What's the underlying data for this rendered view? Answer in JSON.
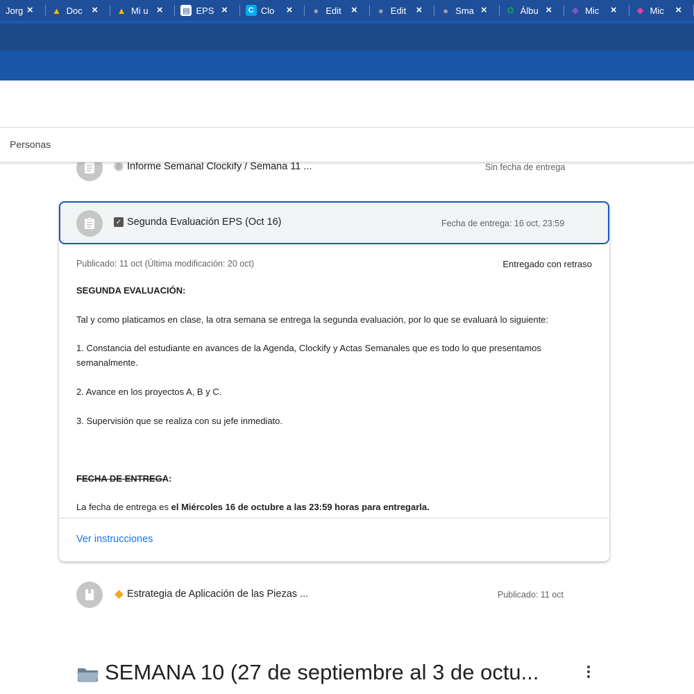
{
  "browser": {
    "tabs": [
      {
        "title": "Jorg",
        "icon": "user-icon",
        "icon_color": "#1f4f9a"
      },
      {
        "title": "Doc",
        "icon": "google-drive-icon",
        "icon_color": "#ffffff"
      },
      {
        "title": "Mi u",
        "icon": "google-drive-icon",
        "icon_color": "#ffffff"
      },
      {
        "title": "EPS",
        "icon": "google-forms-icon",
        "icon_color": "#ffffff"
      },
      {
        "title": "Clo",
        "icon": "clockify-icon",
        "icon_color": "#03a9f4"
      },
      {
        "title": "Edit",
        "icon": "globe-icon",
        "icon_color": "#9aa0a6"
      },
      {
        "title": "Edit",
        "icon": "globe-icon",
        "icon_color": "#9aa0a6"
      },
      {
        "title": "Sma",
        "icon": "globe-icon",
        "icon_color": "#9aa0a6"
      },
      {
        "title": "Álbu",
        "icon": "clover-icon",
        "icon_color": "#0f9d58"
      },
      {
        "title": "Mic",
        "icon": "copilot-icon",
        "icon_color": "#7e57c2"
      },
      {
        "title": "Mic",
        "icon": "copilot-icon",
        "icon_color": "#e040a0"
      }
    ],
    "close_glyph": "×"
  },
  "classroom": {
    "people_label": "Personas",
    "items": [
      {
        "title": "Informe Semanal Clockify / Semana 11 ...",
        "prefix_icon": "seal-emoji-icon",
        "meta": "Sin fecha de entrega"
      },
      {
        "title": "Estrategia de Aplicación de las Piezas ...",
        "prefix_icon": "orange-diamond-emoji-icon",
        "meta": "Publicado: 11 oct"
      }
    ],
    "expanded": {
      "title": "Segunda Evaluación EPS (Oct 16)",
      "prefix_icon": "checkbox-emoji-icon",
      "due": "Fecha de entrega: 16 oct, 23:59",
      "published": "Publicado: 11 oct (Última modificación: 20 oct)",
      "status": "Entregado con retraso",
      "heading1": "SEGUNDA EVALUACIÓN:",
      "intro": "Tal y como platicamos en clase, la otra semana se entrega la segunda evaluación, por lo que se evaluará lo siguiente:",
      "point1": "1. Constancia del estudiante en avances de la Agenda, Clockify y Actas Semanales que es todo lo que presentamos semanalmente.",
      "point2": "2. Avance en los proyectos A, B y C.",
      "point3": "3. Supervisión que se realiza con su jefe inmediato.",
      "heading2": "FECHA DE ENTREGA:",
      "due_text_prefix": "La fecha de entrega es ",
      "due_text_bold": "el Miércoles 16 de octubre a las 23:59 horas para entregarla.",
      "link_label": "Ver instrucciones"
    },
    "section_title": "SEMANA 10 (27 de septiembre al 3 de octu...",
    "section_icon": "folder-emoji-icon"
  },
  "colors": {
    "tab_strip": "#1f4f9a",
    "header_band": "#1a57a6",
    "selection_border": "#1a56c4",
    "link": "#1a73e8",
    "icon_circle": "#c4c7c5"
  }
}
